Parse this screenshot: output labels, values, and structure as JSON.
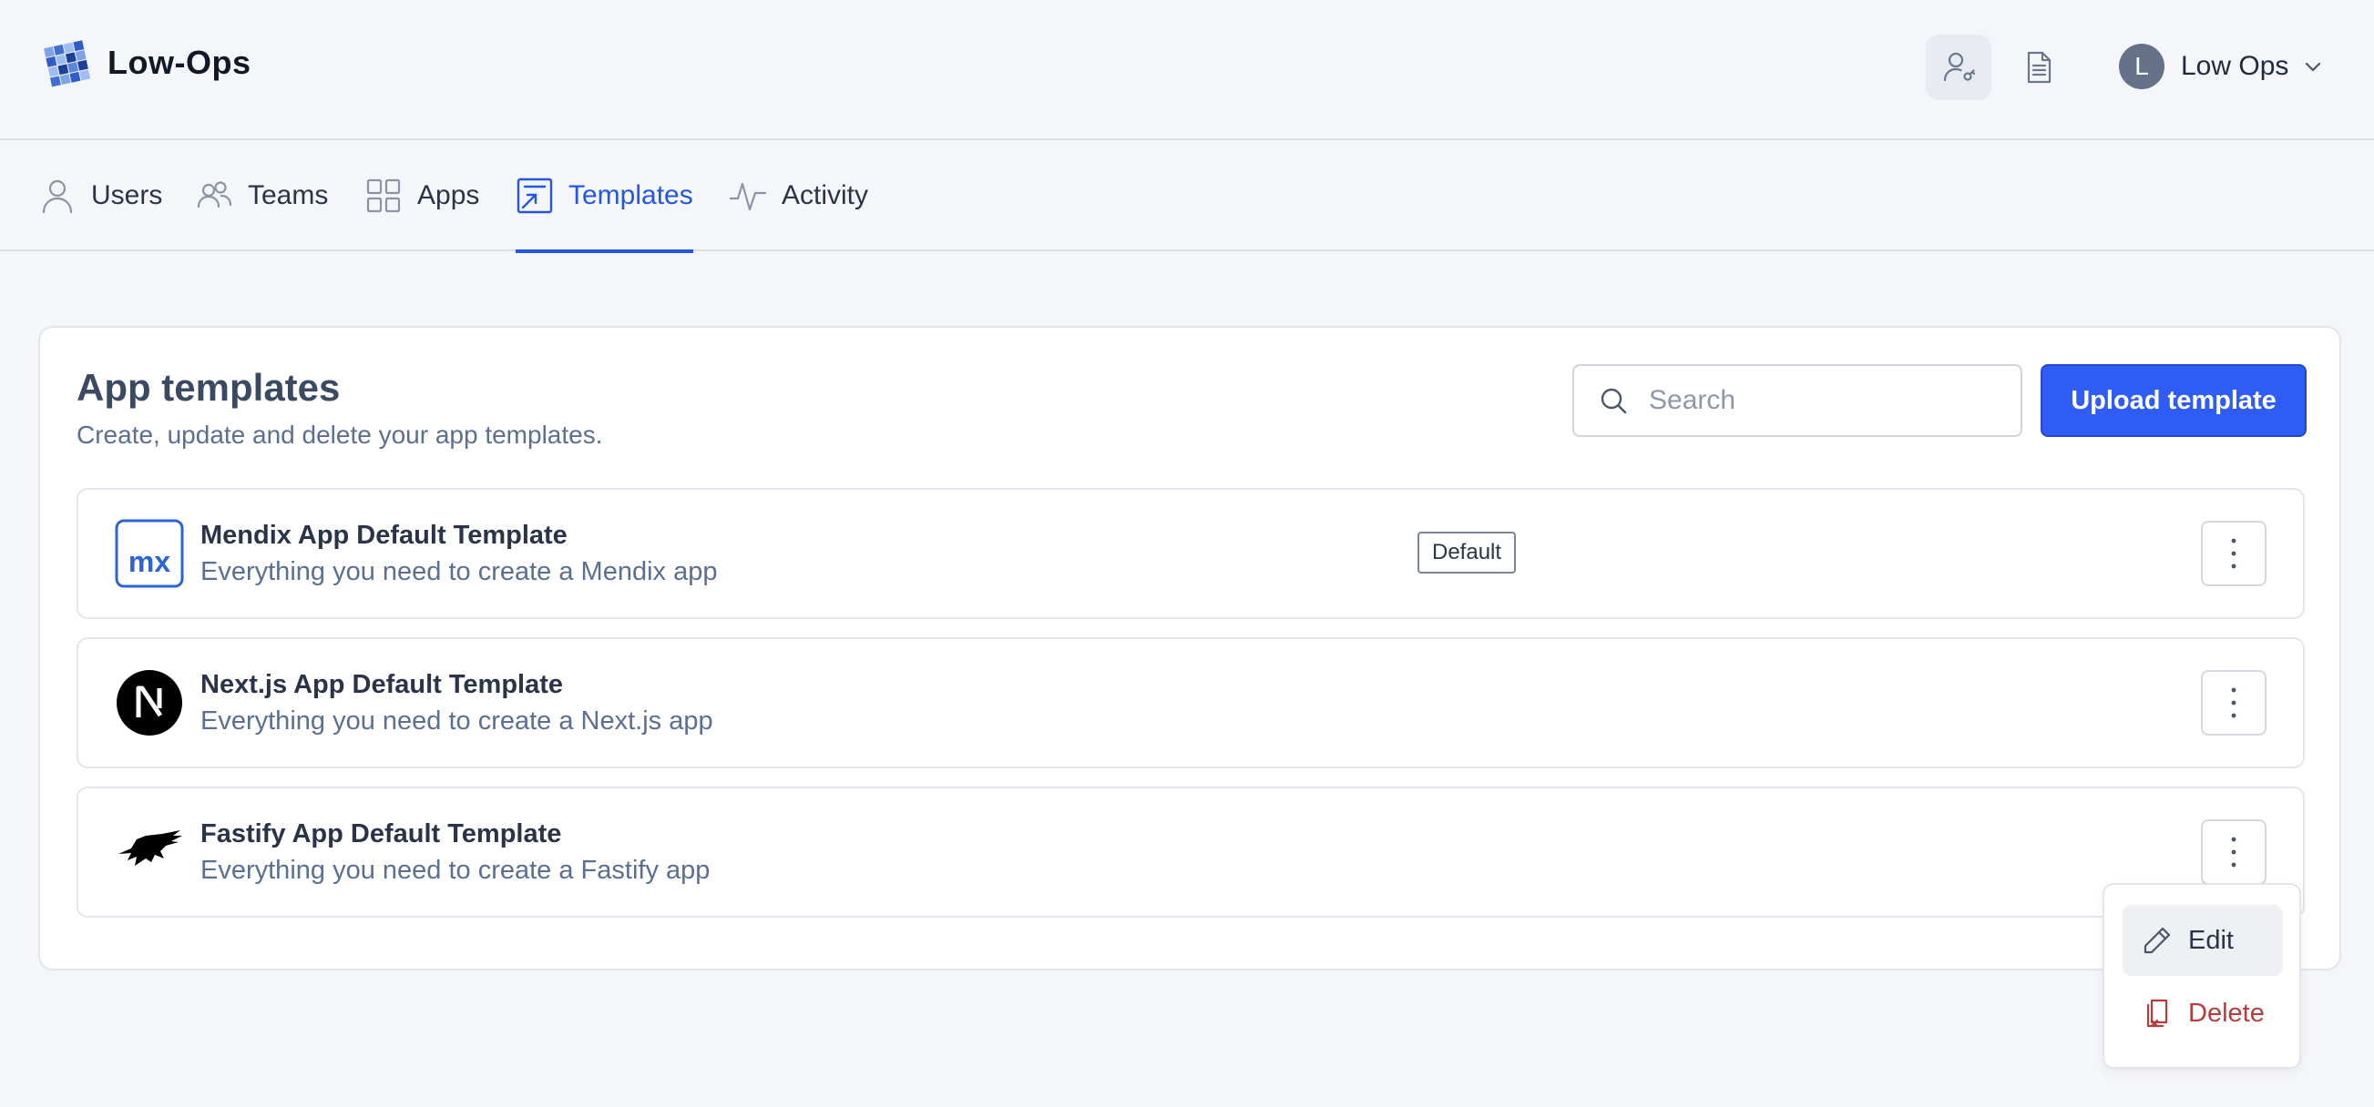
{
  "header": {
    "brand_name": "Low-Ops",
    "user": {
      "initial": "L",
      "name": "Low Ops"
    }
  },
  "tabs": [
    {
      "label": "Users",
      "icon": "user-icon"
    },
    {
      "label": "Teams",
      "icon": "users-icon"
    },
    {
      "label": "Apps",
      "icon": "grid-icon"
    },
    {
      "label": "Templates",
      "icon": "template-icon",
      "active": true
    },
    {
      "label": "Activity",
      "icon": "activity-icon"
    }
  ],
  "main": {
    "title": "App templates",
    "subtitle": "Create, update and delete your app templates.",
    "search": {
      "placeholder": "Search",
      "value": ""
    },
    "upload_label": "Upload template",
    "templates": [
      {
        "name": "Mendix App Default Template",
        "description": "Everything you need to create a Mendix app",
        "logo": "mendix-logo",
        "badge": "Default"
      },
      {
        "name": "Next.js App Default Template",
        "description": "Everything you need to create a Next.js app",
        "logo": "nextjs-logo"
      },
      {
        "name": "Fastify App Default Template",
        "description": "Everything you need to create a Fastify app",
        "logo": "fastify-logo"
      }
    ]
  },
  "menu": {
    "edit_label": "Edit",
    "delete_label": "Delete"
  },
  "colors": {
    "accent": "#2f5cf5",
    "active_tab": "#2457e0",
    "danger": "#b93b3b"
  }
}
